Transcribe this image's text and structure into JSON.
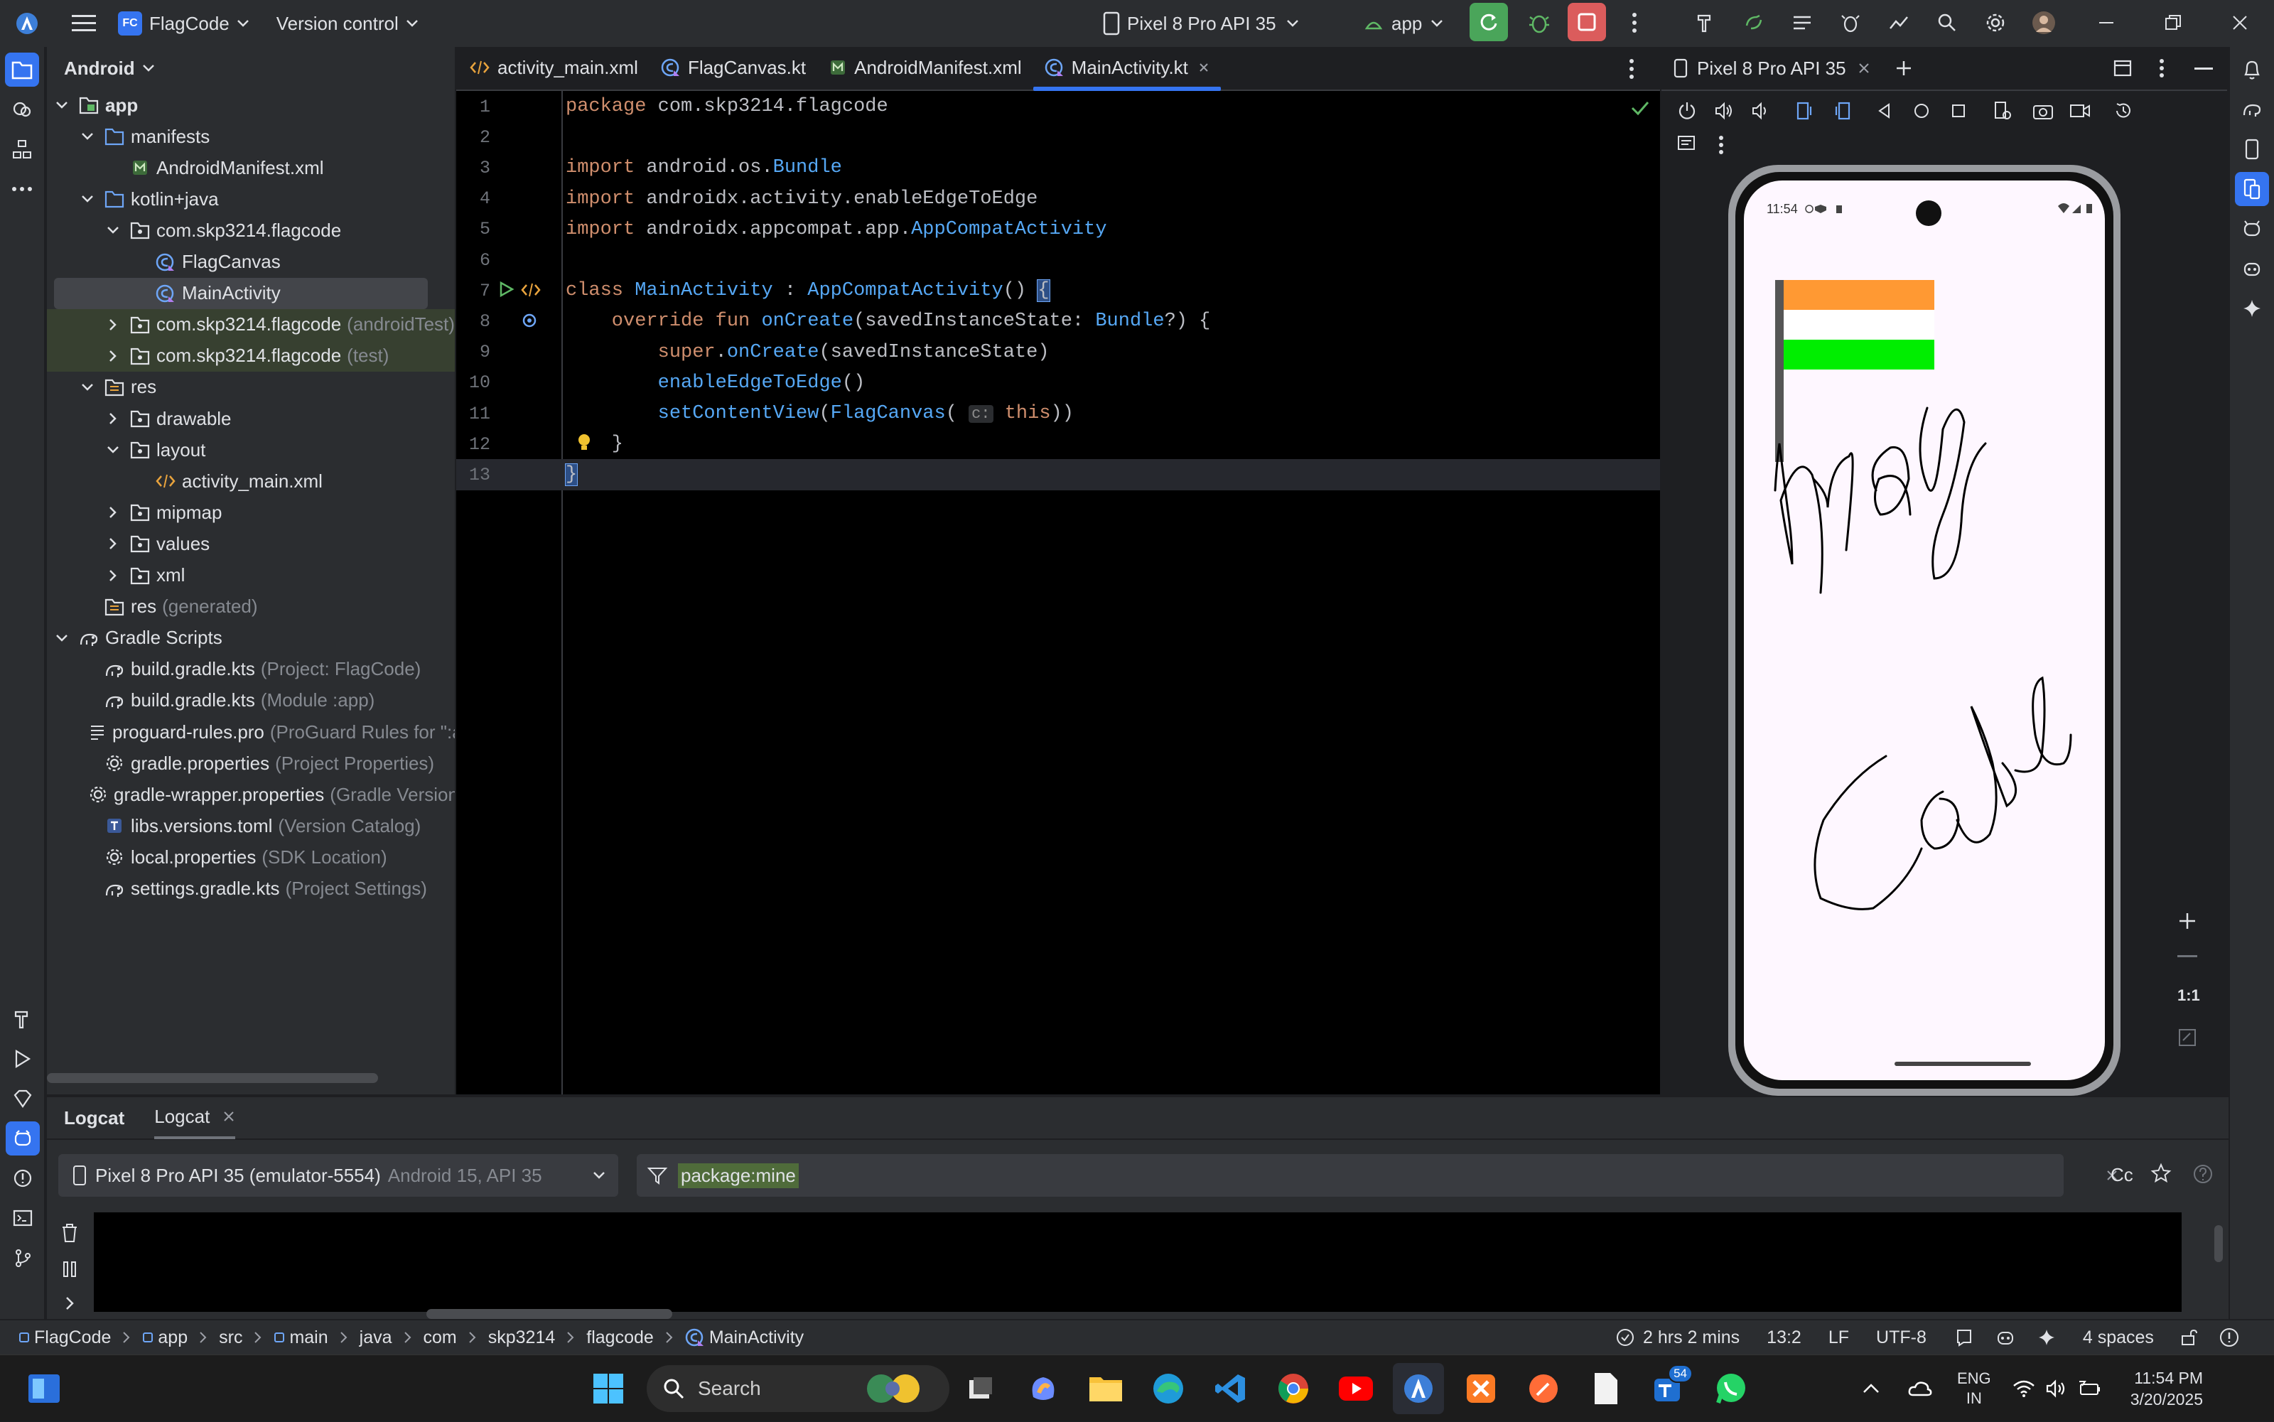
{
  "window": {
    "project_badge": "FC",
    "project_name": "FlagCode",
    "vcs": "Version control",
    "device": "Pixel 8 Pro API 35",
    "run_config": "app"
  },
  "project_panel": {
    "view": "Android",
    "tree": [
      {
        "label": "app",
        "hint": "",
        "icon": "module-folder-icon",
        "depth": 0,
        "expanded": true,
        "bold": true
      },
      {
        "label": "manifests",
        "hint": "",
        "icon": "folder-icon",
        "depth": 1,
        "expanded": true
      },
      {
        "label": "AndroidManifest.xml",
        "hint": "",
        "icon": "manifest-file-icon",
        "depth": 2,
        "expanded": null
      },
      {
        "label": "kotlin+java",
        "hint": "",
        "icon": "folder-icon",
        "depth": 1,
        "expanded": true
      },
      {
        "label": "com.skp3214.flagcode",
        "hint": "",
        "icon": "package-icon",
        "depth": 2,
        "expanded": true
      },
      {
        "label": "FlagCanvas",
        "hint": "",
        "icon": "kotlin-class-icon",
        "depth": 3,
        "expanded": null
      },
      {
        "label": "MainActivity",
        "hint": "",
        "icon": "kotlin-class-icon",
        "depth": 3,
        "expanded": null,
        "selected": true
      },
      {
        "label": "com.skp3214.flagcode",
        "hint": "(androidTest)",
        "icon": "package-icon",
        "depth": 2,
        "expanded": false,
        "test": true
      },
      {
        "label": "com.skp3214.flagcode",
        "hint": "(test)",
        "icon": "package-icon",
        "depth": 2,
        "expanded": false,
        "test": true
      },
      {
        "label": "res",
        "hint": "",
        "icon": "res-folder-icon",
        "depth": 1,
        "expanded": true
      },
      {
        "label": "drawable",
        "hint": "",
        "icon": "package-icon",
        "depth": 2,
        "expanded": false
      },
      {
        "label": "layout",
        "hint": "",
        "icon": "package-icon",
        "depth": 2,
        "expanded": true
      },
      {
        "label": "activity_main.xml",
        "hint": "",
        "icon": "xml-file-icon",
        "depth": 3,
        "expanded": null
      },
      {
        "label": "mipmap",
        "hint": "",
        "icon": "package-icon",
        "depth": 2,
        "expanded": false
      },
      {
        "label": "values",
        "hint": "",
        "icon": "package-icon",
        "depth": 2,
        "expanded": false
      },
      {
        "label": "xml",
        "hint": "",
        "icon": "package-icon",
        "depth": 2,
        "expanded": false
      },
      {
        "label": "res",
        "hint": "(generated)",
        "icon": "res-folder-icon",
        "depth": 1,
        "expanded": null
      },
      {
        "label": "Gradle Scripts",
        "hint": "",
        "icon": "gradle-icon",
        "depth": 0,
        "expanded": true
      },
      {
        "label": "build.gradle.kts",
        "hint": "(Project: FlagCode)",
        "icon": "gradle-icon",
        "depth": 1,
        "expanded": null
      },
      {
        "label": "build.gradle.kts",
        "hint": "(Module :app)",
        "icon": "gradle-icon",
        "depth": 1,
        "expanded": null
      },
      {
        "label": "proguard-rules.pro",
        "hint": "(ProGuard Rules for \":app\")",
        "icon": "text-file-icon",
        "depth": 1,
        "expanded": null
      },
      {
        "label": "gradle.properties",
        "hint": "(Project Properties)",
        "icon": "settings-file-icon",
        "depth": 1,
        "expanded": null
      },
      {
        "label": "gradle-wrapper.properties",
        "hint": "(Gradle Version)",
        "icon": "settings-file-icon",
        "depth": 1,
        "expanded": null
      },
      {
        "label": "libs.versions.toml",
        "hint": "(Version Catalog)",
        "icon": "toml-file-icon",
        "depth": 1,
        "expanded": null
      },
      {
        "label": "local.properties",
        "hint": "(SDK Location)",
        "icon": "settings-file-icon",
        "depth": 1,
        "expanded": null
      },
      {
        "label": "settings.gradle.kts",
        "hint": "(Project Settings)",
        "icon": "gradle-icon",
        "depth": 1,
        "expanded": null
      }
    ]
  },
  "editor": {
    "tabs": [
      {
        "label": "activity_main.xml",
        "icon": "xml-file-icon",
        "active": false
      },
      {
        "label": "FlagCanvas.kt",
        "icon": "kotlin-class-icon",
        "active": false
      },
      {
        "label": "AndroidManifest.xml",
        "icon": "manifest-file-icon",
        "active": false
      },
      {
        "label": "MainActivity.kt",
        "icon": "kotlin-class-icon",
        "active": true
      }
    ],
    "lines": [
      [
        {
          "t": "package ",
          "c": "kw"
        },
        {
          "t": "com.skp3214.flagcode",
          "c": "pkg"
        }
      ],
      [],
      [
        {
          "t": "import ",
          "c": "kw"
        },
        {
          "t": "android.os.",
          "c": "pkg"
        },
        {
          "t": "Bundle",
          "c": "cls"
        }
      ],
      [
        {
          "t": "import ",
          "c": "kw"
        },
        {
          "t": "androidx.activity.enableEdgeToEdge",
          "c": "pkg"
        }
      ],
      [
        {
          "t": "import ",
          "c": "kw"
        },
        {
          "t": "androidx.appcompat.app.",
          "c": "pkg"
        },
        {
          "t": "AppCompatActivity",
          "c": "cls"
        }
      ],
      [],
      [
        {
          "t": "class ",
          "c": "kw"
        },
        {
          "t": "MainActivity",
          "c": "cls"
        },
        {
          "t": " : ",
          "c": "pkg"
        },
        {
          "t": "AppCompatActivity",
          "c": "cls"
        },
        {
          "t": "() ",
          "c": "pkg"
        },
        {
          "t": "{",
          "c": "brace"
        }
      ],
      [
        {
          "t": "    override fun ",
          "c": "kw"
        },
        {
          "t": "onCreate",
          "c": "fnd"
        },
        {
          "t": "(savedInstanceState: ",
          "c": "pkg"
        },
        {
          "t": "Bundle",
          "c": "cls"
        },
        {
          "t": "?) {",
          "c": "pkg"
        }
      ],
      [
        {
          "t": "        super",
          "c": "kw"
        },
        {
          "t": ".",
          "c": "pkg"
        },
        {
          "t": "onCreate",
          "c": "call"
        },
        {
          "t": "(savedInstanceState)",
          "c": "pkg"
        }
      ],
      [
        {
          "t": "        enableEdgeToEdge",
          "c": "call"
        },
        {
          "t": "()",
          "c": "pkg"
        }
      ],
      [
        {
          "t": "        setContentView",
          "c": "call"
        },
        {
          "t": "(",
          "c": "pkg"
        },
        {
          "t": "FlagCanvas",
          "c": "cls"
        },
        {
          "t": "( ",
          "c": "pkg"
        },
        {
          "t": "c:",
          "c": "hint"
        },
        {
          "t": " this",
          "c": "kw"
        },
        {
          "t": "))",
          "c": "pkg"
        }
      ],
      [
        {
          "t": "    }",
          "c": "pkg"
        }
      ],
      [
        {
          "t": "}",
          "c": "brace"
        }
      ]
    ]
  },
  "emulator": {
    "tab": "Pixel 8 Pro API 35",
    "clock": "11:54",
    "zoom_label": "1:1",
    "flag_colors": {
      "saffron": "#ff9933",
      "white": "#ffffff",
      "green": "#00ee00",
      "pole": "#555555"
    }
  },
  "logcat": {
    "tab_header": "Logcat",
    "tab": "Logcat",
    "device": "Pixel 8 Pro API 35 (emulator-5554)",
    "device_hint": "Android 15, API 35",
    "filter": "package:mine",
    "cc": "Cc"
  },
  "status_bar": {
    "breadcrumb": [
      "FlagCode",
      "app",
      "src",
      "main",
      "java",
      "com",
      "skp3214",
      "flagcode",
      "MainActivity"
    ],
    "time_elapsed": "2 hrs 2 mins",
    "position": "13:2",
    "line_sep": "LF",
    "encoding": "UTF-8",
    "indent": "4 spaces"
  },
  "taskbar": {
    "search": "Search",
    "lang": "ENG",
    "region": "IN",
    "time": "11:54 PM",
    "date": "3/20/2025",
    "badge": "54"
  }
}
